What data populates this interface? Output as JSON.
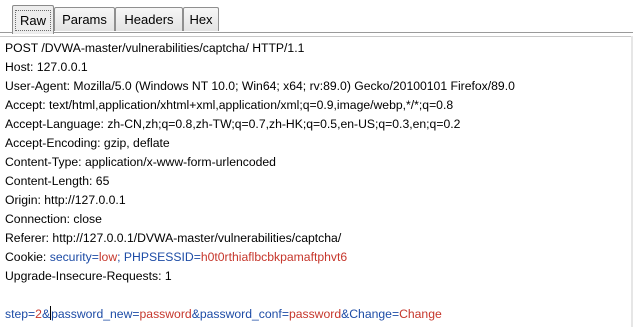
{
  "tabs": [
    {
      "label": "Raw",
      "active": true
    },
    {
      "label": "Params",
      "active": false
    },
    {
      "label": "Headers",
      "active": false
    },
    {
      "label": "Hex",
      "active": false
    }
  ],
  "request": {
    "lines": [
      "POST /DVWA-master/vulnerabilities/captcha/ HTTP/1.1",
      "Host: 127.0.0.1",
      "User-Agent: Mozilla/5.0 (Windows NT 10.0; Win64; x64; rv:89.0) Gecko/20100101 Firefox/89.0",
      "Accept: text/html,application/xhtml+xml,application/xml;q=0.9,image/webp,*/*;q=0.8",
      "Accept-Language: zh-CN,zh;q=0.8,zh-TW;q=0.7,zh-HK;q=0.5,en-US;q=0.3,en;q=0.2",
      "Accept-Encoding: gzip, deflate",
      "Content-Type: application/x-www-form-urlencoded",
      "Content-Length: 65",
      "Origin: http://127.0.0.1",
      "Connection: close",
      "Referer: http://127.0.0.1/DVWA-master/vulnerabilities/captcha/"
    ],
    "cookie": {
      "prefix": "Cookie: ",
      "name1": "security",
      "eq1": "=",
      "value1": "low",
      "sep": "; ",
      "name2": "PHPSESSID",
      "eq2": "=",
      "value2": "h0t0rthiaflbcbkpamaftphvt6"
    },
    "upgrade": "Upgrade-Insecure-Requests: 1",
    "body": {
      "p1_name": "step",
      "eq": "=",
      "p1_value": "2",
      "amp": "&",
      "p2_name": "password_new",
      "p2_value": "password",
      "p3_name": "password_conf",
      "p3_value": "password",
      "p4_name": "Change",
      "p4_value": "Change"
    }
  },
  "colors": {
    "param_name": "#1d4ca6",
    "param_value": "#c6372c"
  }
}
